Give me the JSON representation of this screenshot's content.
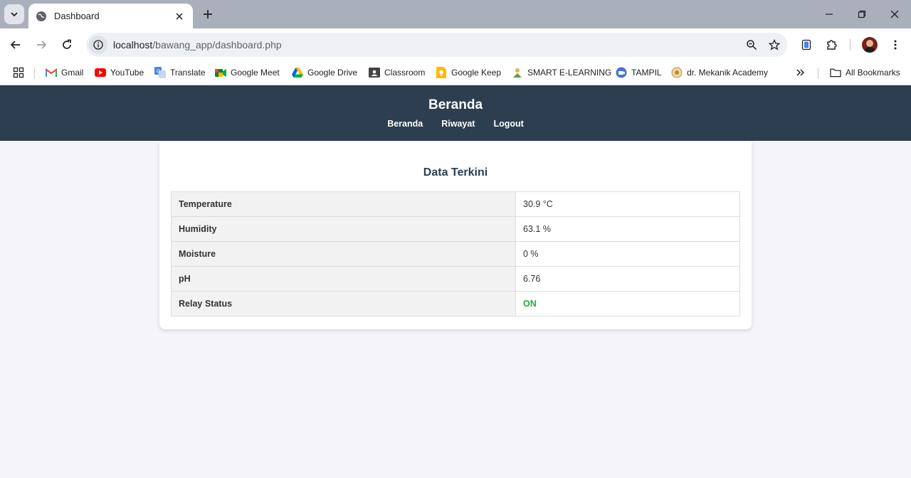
{
  "browser": {
    "tab_title": "Dashboard",
    "url_host": "localhost",
    "url_path": "/bawang_app/dashboard.php",
    "bookmarks": [
      {
        "label": "Gmail",
        "icon": "gmail-icon"
      },
      {
        "label": "YouTube",
        "icon": "youtube-icon"
      },
      {
        "label": "Translate",
        "icon": "translate-icon"
      },
      {
        "label": "Google Meet",
        "icon": "google-meet-icon"
      },
      {
        "label": "Google Drive",
        "icon": "google-drive-icon"
      },
      {
        "label": "Classroom",
        "icon": "classroom-icon"
      },
      {
        "label": "Google Keep",
        "icon": "google-keep-icon"
      },
      {
        "label": "SMART E-LEARNING",
        "icon": "smart-elearning-icon"
      },
      {
        "label": "TAMPIL",
        "icon": "tampil-icon"
      },
      {
        "label": "dr. Mekanik Academy",
        "icon": "mekanik-academy-icon"
      }
    ],
    "all_bookmarks": "All Bookmarks",
    "overflow": "»"
  },
  "header": {
    "title": "Beranda",
    "nav": [
      "Beranda",
      "Riwayat",
      "Logout"
    ]
  },
  "card": {
    "title": "Data Terkini",
    "rows": [
      {
        "label": "Temperature",
        "value": "30.9 °C"
      },
      {
        "label": "Humidity",
        "value": "63.1 %"
      },
      {
        "label": "Moisture",
        "value": "0 %"
      },
      {
        "label": "pH",
        "value": "6.76"
      },
      {
        "label": "Relay Status",
        "value": "ON"
      }
    ]
  },
  "colors": {
    "header_bg": "#2c3e50",
    "status_on": "#28a745"
  }
}
